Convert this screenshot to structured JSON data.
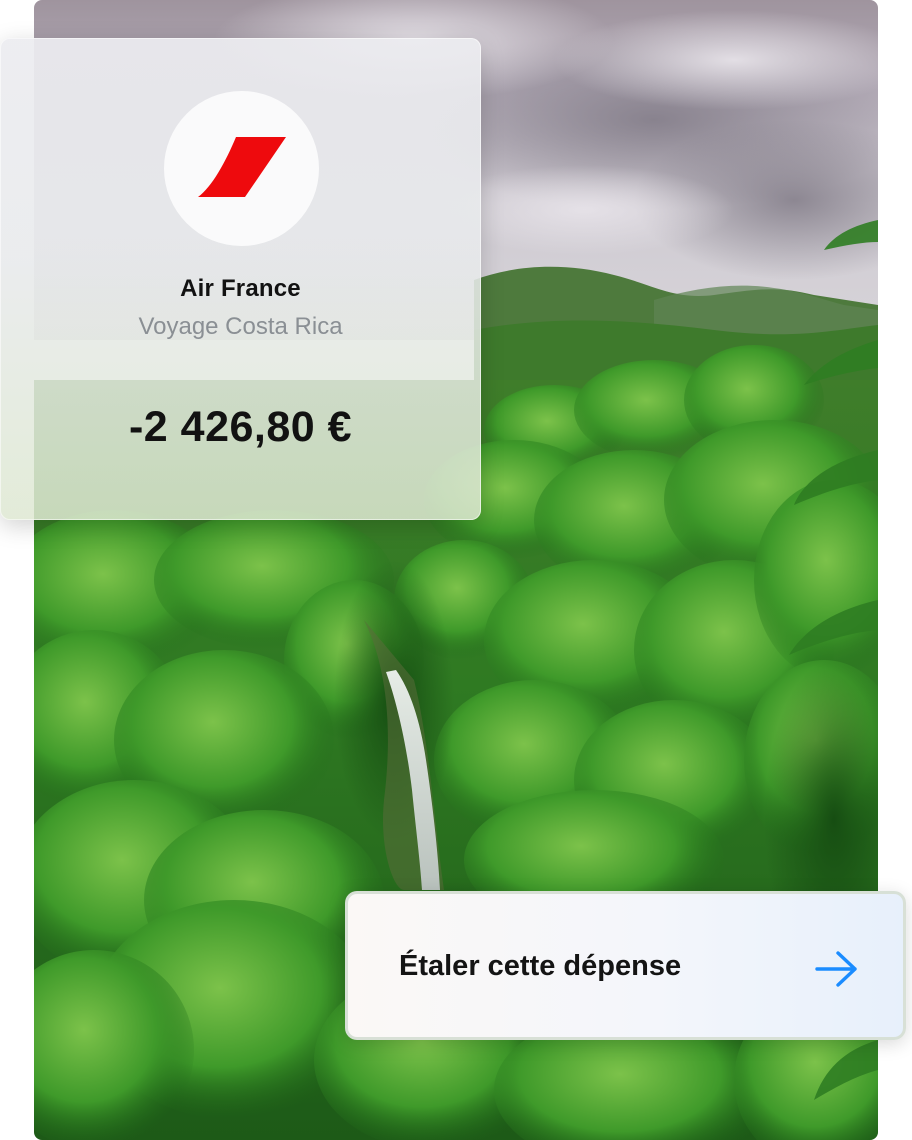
{
  "transaction": {
    "merchant": "Air France",
    "description": "Voyage Costa Rica",
    "amount": "-2 426,80 €",
    "logo_icon": "air-france-logo",
    "logo_color": "#ee0a0d"
  },
  "action": {
    "label": "Étaler cette dépense",
    "icon": "arrow-right-icon",
    "icon_color": "#1a8cff"
  },
  "background": {
    "scene": "rainforest-waterfall-photo"
  }
}
